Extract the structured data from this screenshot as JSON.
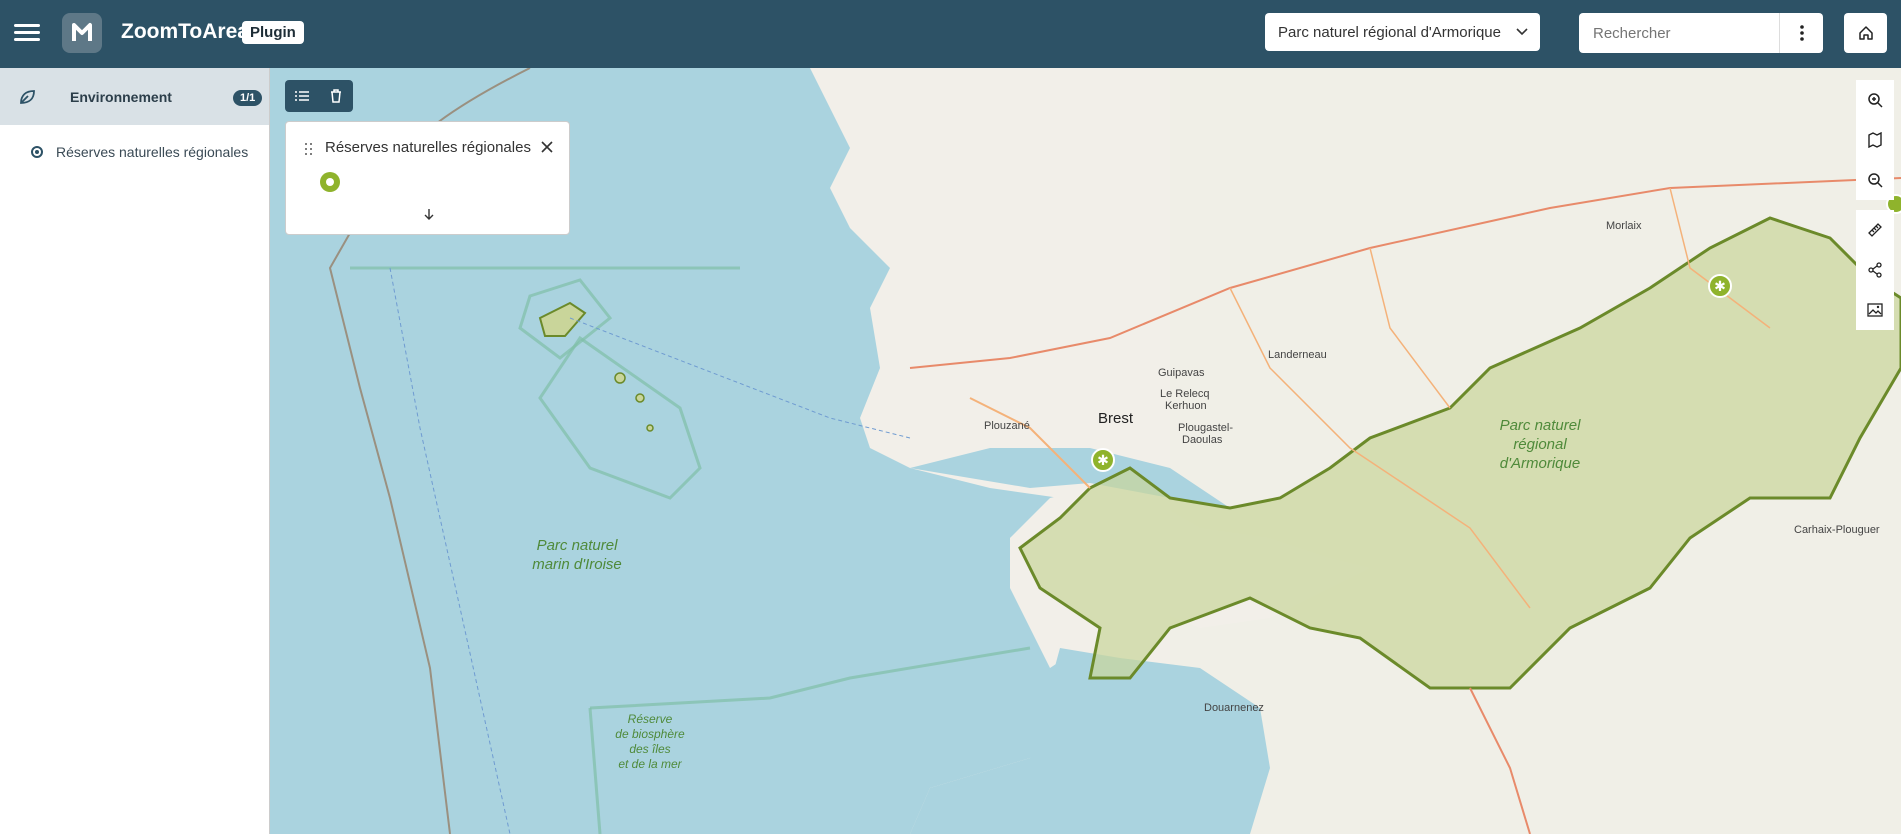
{
  "header": {
    "app_title": "ZoomToArea",
    "plugin_badge": "Plugin",
    "area_select_value": "Parc naturel régional d'Armorique",
    "search_placeholder": "Rechercher"
  },
  "sidebar": {
    "category": {
      "label": "Environnement",
      "count": "1/1"
    },
    "items": [
      {
        "label": "Réserves naturelles régionales"
      }
    ]
  },
  "legend": {
    "title": "Réserves naturelles régionales"
  },
  "map": {
    "labels": {
      "brest": "Brest",
      "guipavas": "Guipavas",
      "relecq": "Le Relecq",
      "kerhuon": "Kerhuon",
      "plougastel": "Plougastel-",
      "daoulas": "Daoulas",
      "plouzane": "Plouzané",
      "landerneau": "Landerneau",
      "morlaix": "Morlaix",
      "carhaix": "Carhaix-Plouguer",
      "douarnenez": "Douarnenez"
    },
    "park_armorique": [
      "Parc naturel",
      "régional",
      "d'Armorique"
    ],
    "park_iroise": [
      "Parc naturel",
      "marin d'Iroise"
    ],
    "biosphere": [
      "Réserve",
      "de biosphère",
      "des îles",
      "et de la mer"
    ]
  },
  "colors": {
    "header_bg": "#2d5266",
    "sea": "#aad3df",
    "land": "#f2efe9",
    "park_fill": "#c9d59a",
    "park_stroke": "#6b8a2a",
    "marker": "#8fb32c"
  }
}
